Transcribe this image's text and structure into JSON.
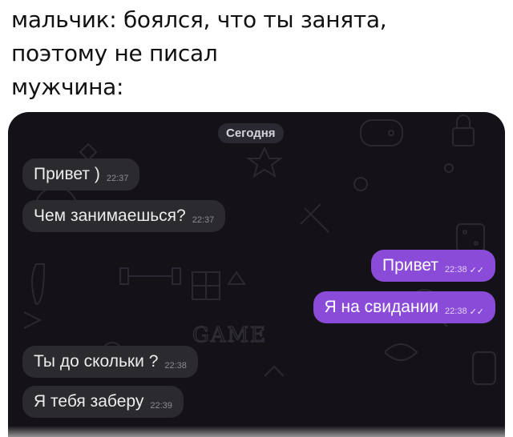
{
  "caption": {
    "line1": "мальчик: боялся, что ты занята,",
    "line2": "поэтому не писал",
    "line3": "мужчина:"
  },
  "chat": {
    "date_label": "Сегодня",
    "messages": [
      {
        "side": "in",
        "text": "Привет )",
        "time": "22:37"
      },
      {
        "side": "in",
        "text": "Чем занимаешься?",
        "time": "22:37"
      },
      {
        "side": "out",
        "text": "Привет",
        "time": "22:38",
        "status": "✓✓"
      },
      {
        "side": "out",
        "text": "Я на свидании",
        "time": "22:38",
        "status": "✓✓"
      },
      {
        "side": "in",
        "text": "Ты до скольки ?",
        "time": "22:38"
      },
      {
        "side": "in",
        "text": "Я тебя заберу",
        "time": "22:39"
      }
    ],
    "background_text": "GAME"
  },
  "colors": {
    "chat_bg": "#141217",
    "incoming_bubble": "#2b2a2e",
    "outgoing_bubble": "#8a4bd9",
    "date_badge": "#2a2830"
  },
  "icons": [
    "gamepad-icon",
    "star-icon",
    "disc-icon",
    "lock-icon",
    "dice-icon",
    "bowling-icon",
    "dumbbell-icon",
    "sword-icon",
    "puzzle-cube-icon",
    "ping-pong-icon"
  ]
}
